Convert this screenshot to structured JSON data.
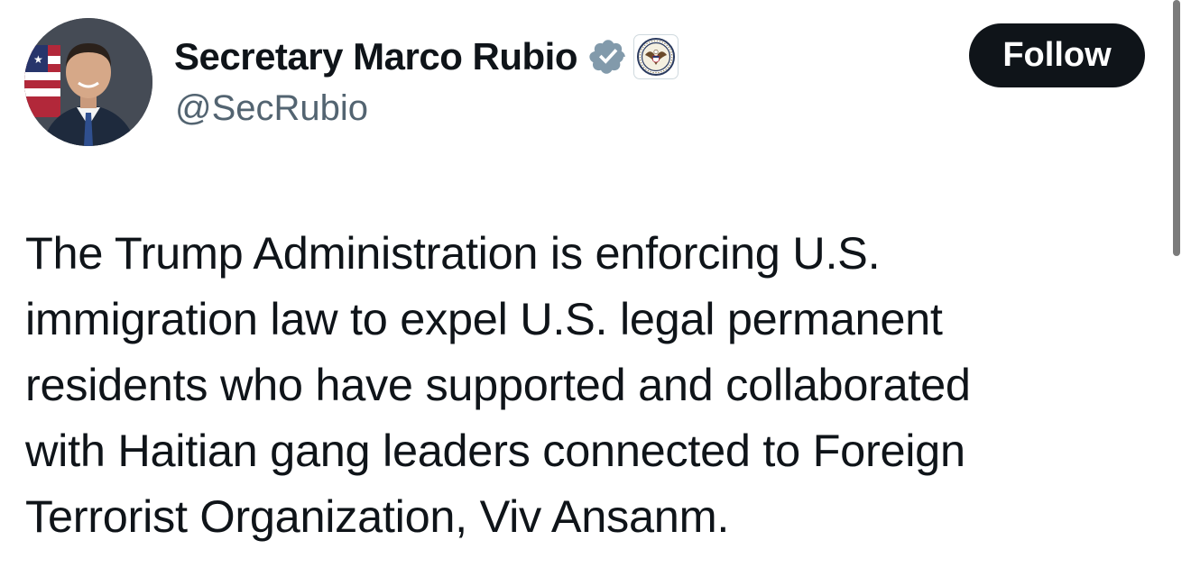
{
  "author": {
    "display_name": "Secretary Marco Rubio",
    "handle": "@SecRubio",
    "avatar": "profile-photo",
    "verified_icon": "verified-badge-icon",
    "affiliate_icon": "state-department-seal-icon"
  },
  "actions": {
    "follow_label": "Follow"
  },
  "tweet": {
    "lines": [
      "The Trump Administration is enforcing U.S.",
      "immigration law to expel U.S. legal permanent",
      "residents who have supported and collaborated",
      "with Haitian gang leaders connected to Foreign",
      "Terrorist Organization, Viv Ansanm."
    ]
  },
  "colors": {
    "text_primary": "#0f1419",
    "text_secondary": "#536471",
    "follow_bg": "#0f1419",
    "follow_text": "#ffffff",
    "verified_badge": "#829aab"
  }
}
